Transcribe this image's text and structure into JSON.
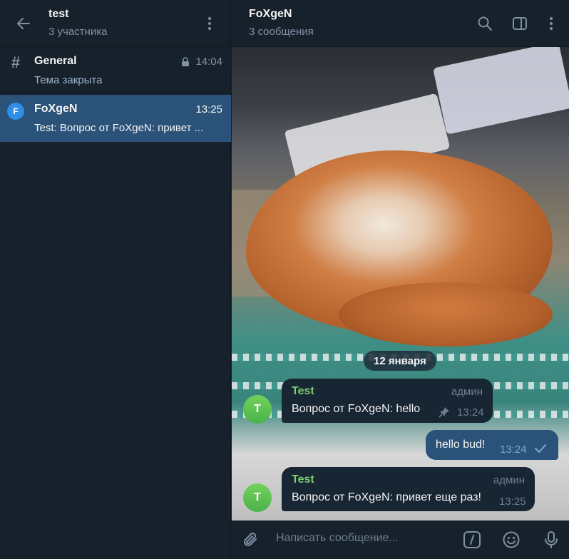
{
  "sidebar": {
    "title": "test",
    "subtitle": "3 участника",
    "topics": [
      {
        "icon": "#",
        "name": "General",
        "time": "14:04",
        "preview": "Тема закрыта",
        "locked": true
      },
      {
        "icon": "F",
        "name": "FoXgeN",
        "time": "13:25",
        "preview": "Test: Вопрос от FoXgeN: привет ...",
        "locked": false
      }
    ]
  },
  "chat": {
    "title": "FoXgeN",
    "subtitle": "3 сообщения",
    "date_separator": "12 января",
    "messages": [
      {
        "direction": "in",
        "author": "Test",
        "role": "админ",
        "avatar_letter": "T",
        "text": "Вопрос от FoXgeN: hello",
        "time": "13:24",
        "pinned": true
      },
      {
        "direction": "out",
        "text": "hello bud!",
        "time": "13:24",
        "read": true
      },
      {
        "direction": "in",
        "author": "Test",
        "role": "админ",
        "avatar_letter": "T",
        "text": "Вопрос от FoXgeN: привет еще раз!",
        "time": "13:25",
        "pinned": false
      }
    ]
  },
  "composer": {
    "placeholder": "Написать сообщение..."
  },
  "colors": {
    "panel_bg": "#17212b",
    "selected_bg": "#2b5278",
    "incoming_bubble": "#182533",
    "outgoing_bubble": "#2b5278",
    "author_name": "#7bcf6e",
    "muted_text": "#7f91a4",
    "avatar_green": "#5cc04e",
    "topic_badge": "#2f8fe6"
  },
  "icons": [
    "arrow-left-icon",
    "kebab-icon",
    "hash-icon",
    "lock-icon",
    "search-icon",
    "sidebar-toggle-icon",
    "pin-icon",
    "check-icon",
    "paperclip-icon",
    "slash-command-icon",
    "emoji-icon",
    "microphone-icon"
  ]
}
